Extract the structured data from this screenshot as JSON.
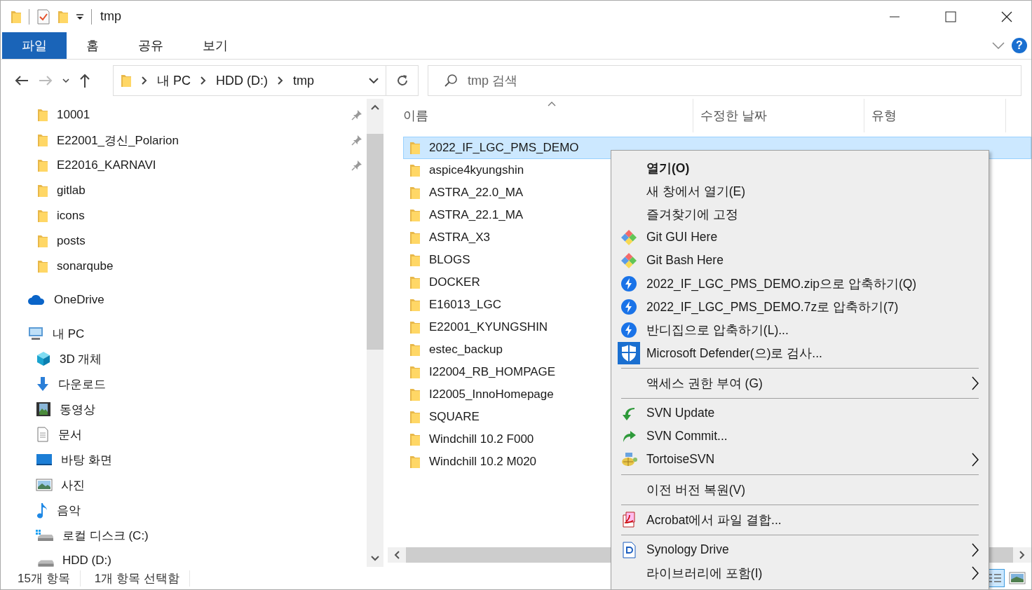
{
  "window": {
    "title": "tmp",
    "help": "?"
  },
  "ribbon_tabs": [
    {
      "label": "파일",
      "selected": true
    },
    {
      "label": "홈",
      "selected": false
    },
    {
      "label": "공유",
      "selected": false
    },
    {
      "label": "보기",
      "selected": false
    }
  ],
  "address": {
    "segments": [
      "내 PC",
      "HDD (D:)",
      "tmp"
    ]
  },
  "search": {
    "placeholder": "tmp 검색"
  },
  "sidebar": {
    "quick_access": [
      {
        "label": "10001",
        "pinned": true
      },
      {
        "label": "E22001_경신_Polarion",
        "pinned": true
      },
      {
        "label": "E22016_KARNAVI",
        "pinned": true
      },
      {
        "label": "gitlab",
        "pinned": false
      },
      {
        "label": "icons",
        "pinned": false
      },
      {
        "label": "posts",
        "pinned": false
      },
      {
        "label": "sonarqube",
        "pinned": false
      }
    ],
    "tree": [
      {
        "label": "OneDrive",
        "kind": "onedrive"
      },
      {
        "label": "내 PC",
        "kind": "pc",
        "children": [
          {
            "label": "3D 개체",
            "kind": "cube"
          },
          {
            "label": "다운로드",
            "kind": "download"
          },
          {
            "label": "동영상",
            "kind": "video"
          },
          {
            "label": "문서",
            "kind": "document"
          },
          {
            "label": "바탕 화면",
            "kind": "desktop"
          },
          {
            "label": "사진",
            "kind": "pictures"
          },
          {
            "label": "음악",
            "kind": "music"
          },
          {
            "label": "로컬 디스크 (C:)",
            "kind": "system-drive"
          },
          {
            "label": "HDD (D:)",
            "kind": "drive"
          }
        ]
      }
    ]
  },
  "table": {
    "columns": [
      "이름",
      "수정한 날짜",
      "유형"
    ],
    "rows": [
      {
        "name": "2022_IF_LGC_PMS_DEMO",
        "selected": true
      },
      {
        "name": "aspice4kyungshin",
        "selected": false
      },
      {
        "name": "ASTRA_22.0_MA",
        "selected": false
      },
      {
        "name": "ASTRA_22.1_MA",
        "selected": false
      },
      {
        "name": "ASTRA_X3",
        "selected": false
      },
      {
        "name": "BLOGS",
        "selected": false
      },
      {
        "name": "DOCKER",
        "selected": false
      },
      {
        "name": "E16013_LGC",
        "selected": false
      },
      {
        "name": "E22001_KYUNGSHIN",
        "selected": false
      },
      {
        "name": "estec_backup",
        "selected": false
      },
      {
        "name": "I22004_RB_HOMPAGE",
        "selected": false
      },
      {
        "name": "I22005_InnoHomepage",
        "selected": false
      },
      {
        "name": "SQUARE",
        "selected": false
      },
      {
        "name": "Windchill 10.2 F000",
        "selected": false
      },
      {
        "name": "Windchill 10.2 M020",
        "selected": false
      }
    ]
  },
  "context_menu": [
    {
      "kind": "plain",
      "label": "열기(O)",
      "default": true,
      "submenu": false
    },
    {
      "kind": "plain",
      "label": "새 창에서 열기(E)",
      "default": false,
      "submenu": false
    },
    {
      "kind": "plain",
      "label": "즐겨찾기에 고정",
      "default": false,
      "submenu": false
    },
    {
      "kind": "git",
      "label": "Git GUI Here",
      "default": false,
      "submenu": false
    },
    {
      "kind": "git",
      "label": "Git Bash Here",
      "default": false,
      "submenu": false
    },
    {
      "kind": "archive",
      "label": "2022_IF_LGC_PMS_DEMO.zip으로 압축하기(Q)",
      "default": false,
      "submenu": false
    },
    {
      "kind": "archive",
      "label": "2022_IF_LGC_PMS_DEMO.7z로 압축하기(7)",
      "default": false,
      "submenu": false
    },
    {
      "kind": "archive",
      "label": "반디집으로 압축하기(L)...",
      "default": false,
      "submenu": false
    },
    {
      "kind": "defender",
      "label": "Microsoft Defender(으)로 검사...",
      "default": false,
      "submenu": false
    },
    {
      "kind": "separator"
    },
    {
      "kind": "plain",
      "label": "액세스 권한 부여 (G)",
      "default": false,
      "submenu": true
    },
    {
      "kind": "separator"
    },
    {
      "kind": "svn-update",
      "label": "SVN Update",
      "default": false,
      "submenu": false
    },
    {
      "kind": "svn-commit",
      "label": "SVN Commit...",
      "default": false,
      "submenu": false
    },
    {
      "kind": "tortoise",
      "label": "TortoiseSVN",
      "default": false,
      "submenu": true
    },
    {
      "kind": "separator"
    },
    {
      "kind": "plain",
      "label": "이전 버전 복원(V)",
      "default": false,
      "submenu": false
    },
    {
      "kind": "separator"
    },
    {
      "kind": "acrobat",
      "label": "Acrobat에서 파일 결합...",
      "default": false,
      "submenu": false
    },
    {
      "kind": "separator"
    },
    {
      "kind": "synology",
      "label": "Synology Drive",
      "default": false,
      "submenu": true
    },
    {
      "kind": "plain",
      "label": "라이브러리에 포함(I)",
      "default": false,
      "submenu": true
    }
  ],
  "status_bar": {
    "items": [
      "15개 항목",
      "1개 항목 선택함"
    ],
    "view_buttons": [
      {
        "kind": "details",
        "selected": true
      },
      {
        "kind": "thumbnails",
        "selected": false
      }
    ]
  }
}
